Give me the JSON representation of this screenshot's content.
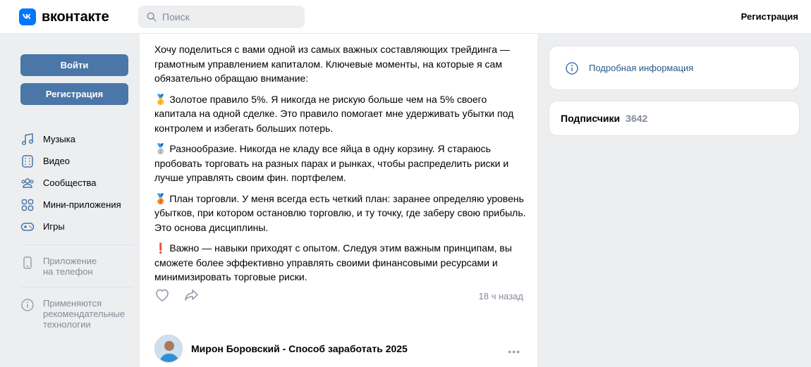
{
  "header": {
    "logo_text": "вконтакте",
    "search_placeholder": "Поиск",
    "register_label": "Регистрация"
  },
  "sidebar": {
    "login_label": "Войти",
    "register_label": "Регистрация",
    "nav": [
      {
        "label": "Музыка",
        "icon": "music-icon"
      },
      {
        "label": "Видео",
        "icon": "video-icon"
      },
      {
        "label": "Сообщества",
        "icon": "communities-icon"
      },
      {
        "label": "Мини-приложения",
        "icon": "apps-icon"
      },
      {
        "label": "Игры",
        "icon": "gamepad-icon"
      }
    ],
    "app_phone": "Приложение на телефон",
    "recommend_tech": "Применяются рекомендательные технологии"
  },
  "post": {
    "paragraphs": [
      "Хочу поделиться с вами одной из самых важных составляющих трейдинга — грамотным управлением капиталом. Ключевые моменты, на которые я сам обязательно обращаю внимание:",
      "🥇 Золотое правило 5%. Я никогда не рискую больше чем на 5% своего капитала на одной сделке. Это правило помогает мне удерживать убытки под контролем и избегать больших потерь.",
      "🥈 Разнообразие. Никогда не кладу все яйца в одну корзину. Я стараюсь пробовать торговать на разных парах и рынках, чтобы распределить риски и лучше управлять своим фин. портфелем.",
      "🥉 План торговли. У меня всегда есть четкий план: заранее определяю уровень убытков, при котором остановлю торговлю, и ту точку, где заберу свою прибыль. Это основа дисциплины.",
      "❗ Важно — навыки приходят с опытом. Следуя этим важным принципам, вы сможете более эффективно управлять своими финансовыми ресурсами и минимизировать торговые риски."
    ],
    "time": "18 ч назад"
  },
  "next_post": {
    "title": "Мирон Боровский - Способ заработать 2025"
  },
  "right": {
    "info_label": "Подробная информация",
    "subscribers_label": "Подписчики",
    "subscribers_count": "3642"
  }
}
